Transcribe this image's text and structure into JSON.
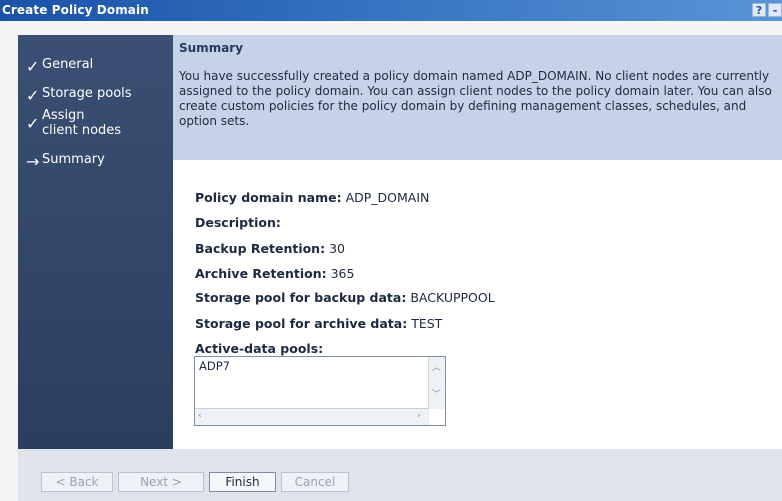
{
  "window": {
    "title": "Create Policy Domain",
    "help_label": "?",
    "minimize_label": "-"
  },
  "sidebar": {
    "items": [
      {
        "label": "General",
        "icon": "✓",
        "status": "complete"
      },
      {
        "label": "Storage pools",
        "icon": "✓",
        "status": "complete"
      },
      {
        "label": "Assign client nodes",
        "icon": "✓",
        "status": "complete"
      },
      {
        "label": "Summary",
        "icon": "→",
        "status": "current"
      }
    ]
  },
  "summary": {
    "title": "Summary",
    "message": "You have successfully created a policy domain named ADP_DOMAIN. No client nodes are currently assigned to the policy domain. You can assign client nodes to the policy domain later. You can also create custom policies for the policy domain by defining management classes, schedules, and option sets."
  },
  "details": {
    "domain_name_label": "Policy domain name:",
    "domain_name_value": "ADP_DOMAIN",
    "description_label": "Description:",
    "description_value": "",
    "backup_retention_label": "Backup Retention:",
    "backup_retention_value": "30",
    "archive_retention_label": "Archive Retention:",
    "archive_retention_value": "365",
    "backup_pool_label": "Storage pool for backup data:",
    "backup_pool_value": "BACKUPPOOL",
    "archive_pool_label": "Storage pool for archive data:",
    "archive_pool_value": "TEST",
    "active_data_pools_label": "Active-data pools:",
    "active_data_pools": [
      "ADP7"
    ]
  },
  "buttons": {
    "back": "< Back",
    "next": "Next >",
    "finish": "Finish",
    "cancel": "Cancel"
  }
}
